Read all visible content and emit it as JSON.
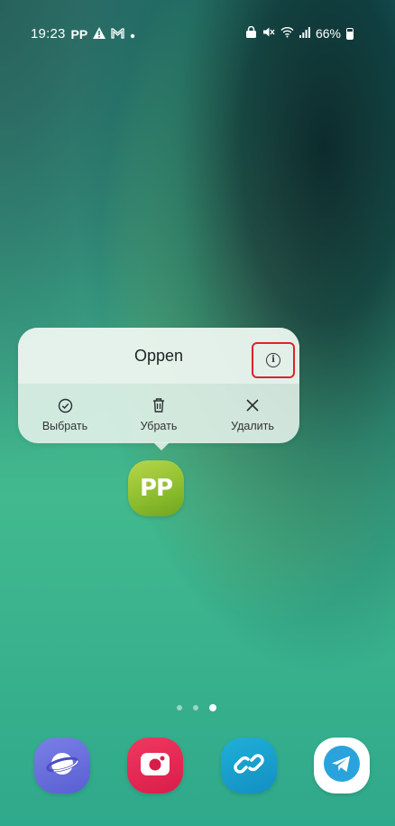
{
  "status_bar": {
    "time": "19:23",
    "notif_app": "PP",
    "battery_percent": "66%"
  },
  "popup": {
    "title": "Oppen",
    "actions": [
      {
        "label": "Выбрать",
        "icon": "check-circle-icon"
      },
      {
        "label": "Убрать",
        "icon": "trash-icon"
      },
      {
        "label": "Удалить",
        "icon": "close-icon"
      }
    ],
    "info_icon": "info-icon"
  },
  "home": {
    "app_icon_text": "PP",
    "page_count": 3,
    "active_page": 3
  },
  "dock": [
    {
      "name": "internet",
      "icon": "planet-icon"
    },
    {
      "name": "camera",
      "icon": "camera-icon"
    },
    {
      "name": "link",
      "icon": "chain-link-icon"
    },
    {
      "name": "telegram",
      "icon": "paper-plane-icon"
    }
  ],
  "colors": {
    "highlight_border": "#d9252a",
    "app_icon_green": "#8fbf2f"
  }
}
